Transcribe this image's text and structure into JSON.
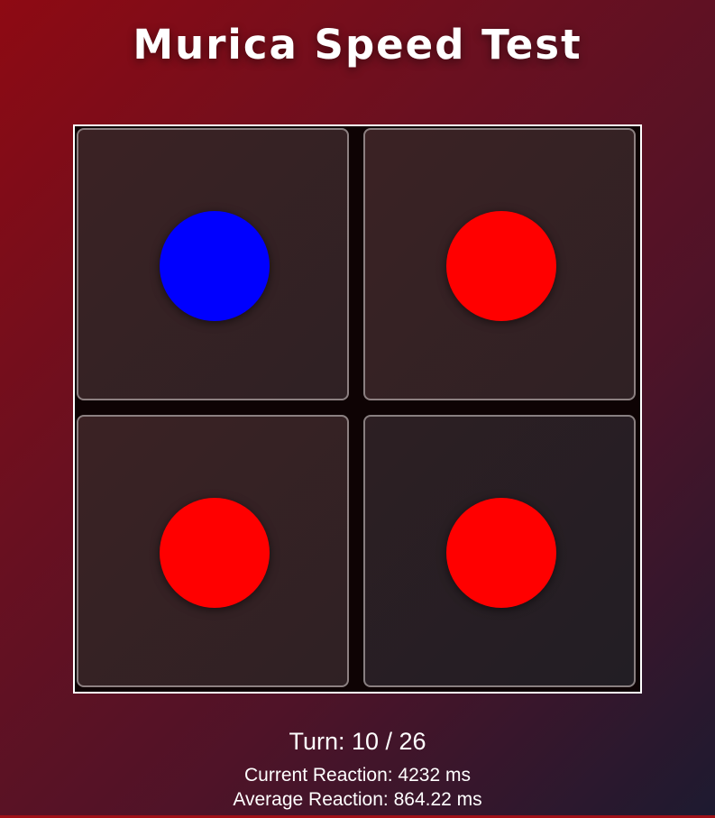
{
  "title": "Murica Speed Test",
  "cells": [
    {
      "index": 0,
      "color": "#0000ff",
      "color_name": "blue"
    },
    {
      "index": 1,
      "color": "#ff0000",
      "color_name": "red"
    },
    {
      "index": 2,
      "color": "#ff0000",
      "color_name": "red"
    },
    {
      "index": 3,
      "color": "#ff0000",
      "color_name": "red"
    }
  ],
  "turn_text": "Turn: 10 / 26",
  "current_reaction_text": "Current Reaction: 4232 ms",
  "average_reaction_text": "Average Reaction: 864.22 ms"
}
